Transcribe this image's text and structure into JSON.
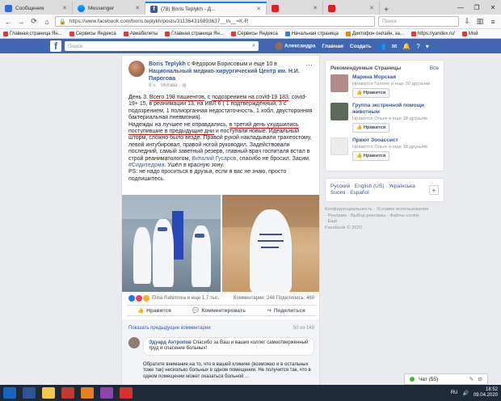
{
  "browser": {
    "tabs": [
      {
        "label": "Сообщения",
        "active": false
      },
      {
        "label": "Messenger",
        "active": false
      },
      {
        "label": "(78) Boris Teplykh - Д...",
        "active": true
      },
      {
        "label": "",
        "active": false
      },
      {
        "label": "",
        "active": false
      }
    ],
    "url": "https://www.facebook.com/boris.teplykh/posts/311364316893637__tn__=K-R",
    "search_placeholder": "Поиск",
    "bookmarks": [
      "Главная страница Ян...",
      "Сервисы Яндекса",
      "Авиабилеты",
      "Главная страница Ян...",
      "Сервисы Яндекса",
      "Начальная страница",
      "Диктофон онлайн, за...",
      "https://yandex.ru/",
      "Мой"
    ]
  },
  "fb_header": {
    "logo": "f",
    "search_placeholder": "Поиск",
    "user_name": "Александра",
    "home": "Главная",
    "create": "Создать"
  },
  "post": {
    "author": "Boris Teplykh",
    "with_text": " с Фёдором Борисовым и еще 10 в ",
    "place": "Национальный медико-хирургический Центр им. Н.И. Пирогова",
    "time": "8 ч. · Москва · ",
    "p1_a": "День 3. ",
    "p1_b": "Всего 198 пациентов",
    "p1_c": ", с ",
    "p1_d": "подозрением на covid-19 183",
    "p1_e": ", covid-19+ 15, в реанимации 13, на ИВЛ 6 ( 1 подтверждённый, 3 с подозрением, 1 полиорганная недостаточность, 1 хобл, двусторонняя бактериальная пневмония).",
    "p2_a": "Надежды на лучшее не оправдались, ",
    "p2_b": "в третий день ухудшились поступившие в предыдущие дни",
    "p2_c": " и поступали новые. Идеальный шторм, сложно было везде. Правой рукой накладывали трахеостому, левой интубировал, правой ногой руководил. Задействовали последний, самый заветный резерв, главный врач госпиталя встал в строй реаниматологом, ",
    "p2_link": "Виталий Гусаров",
    "p2_d": ", спасибо не бросил. Засим, ",
    "p2_tag": "#Сидитедома",
    "p2_e": ". Ушёл в красную зону.",
    "p3": "PS: не надо проситься в друзья, если я вас не знаю, просто подпишитесь.",
    "reactions_text": "Elina Rahimova и еще 1,7 тыс.",
    "counts": "Комментарии: 248  Поделились: 469",
    "like": "Нравится",
    "comment": "Комментировать",
    "share": "Поделиться",
    "prev_comments": "Показать предыдущие комментарии",
    "comment_count": "50 из 149",
    "comment_author": "Эдуард Антропов",
    "comment_text": " Спасибо за Ваш и ваших коллег самоотверженный труд и спасение больных!",
    "comment_cont": "Обратите внимание на то, что в вашей клинике (возможно и в остальных тоже так) несколько больных в одном помещении. Не получится так, что в одном помещении может оказаться больной ..."
  },
  "sidebar": {
    "title": "Рекомендуемые Страницы",
    "all": "Все",
    "pages": [
      {
        "name": "Марина Морская",
        "meta": "Нравится Галене и еще 30 друзьям",
        "btn": "Нравится",
        "color": "#b58a8a"
      },
      {
        "name": "Группа экстренной помощи животным",
        "meta": "Нравится Ольге и еще 18 друзьям",
        "btn": "Нравится",
        "color": "#5d6a5a"
      },
      {
        "name": "Приют Зооассист",
        "meta": "Нравится Ольге и еще 18 друзьям",
        "btn": "Нравится",
        "color": "#e9e9e9"
      }
    ],
    "lang_line1": "Русский · English (US) · Українська",
    "lang_line2": "Suomi · Español",
    "footer1": "Конфиденциальность · Условия использования",
    "footer2": "· Реклама · Выбор рекламы · Файлы cookie",
    "footer3": "· Ещё ·",
    "footer4": "Facebook © 2020"
  },
  "chat": {
    "label": "Чат (55)"
  },
  "taskbar": {
    "lang": "RU",
    "time": "18:52",
    "date": "09.04.2020"
  }
}
